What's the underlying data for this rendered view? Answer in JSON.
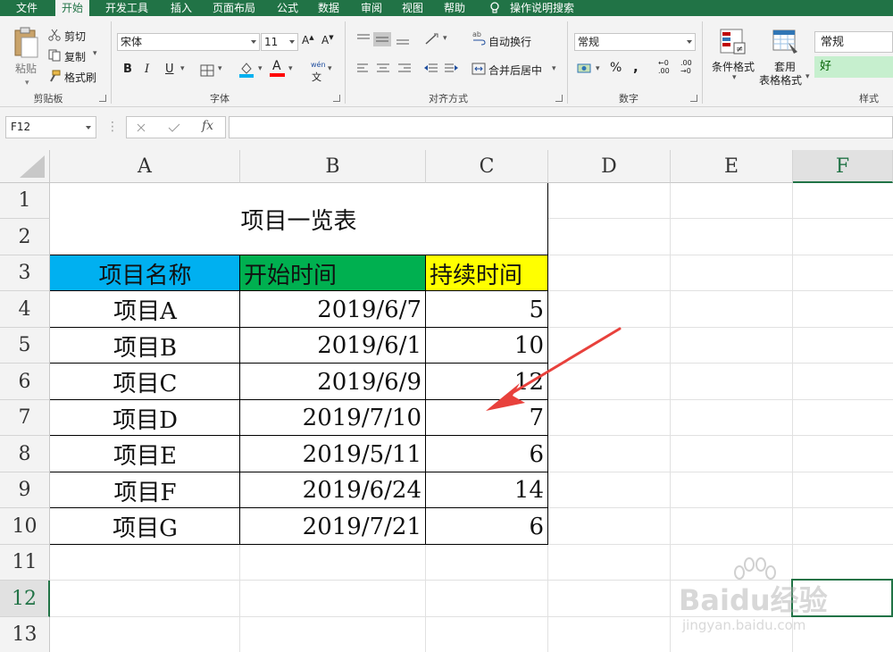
{
  "menu": {
    "tabs": [
      "文件",
      "开始",
      "开发工具",
      "插入",
      "页面布局",
      "公式",
      "数据",
      "审阅",
      "视图",
      "帮助"
    ],
    "active_tab": "开始",
    "tell_me": "操作说明搜索"
  },
  "ribbon": {
    "clipboard": {
      "paste": "粘贴",
      "cut": "剪切",
      "copy": "复制",
      "format_painter": "格式刷",
      "label": "剪贴板"
    },
    "font": {
      "name": "宋体",
      "size": "11",
      "bold": "B",
      "italic": "I",
      "underline": "U",
      "grow": "A",
      "shrink": "A",
      "font_color_glyph": "A",
      "wen": "wén",
      "wen_char": "文",
      "label": "字体"
    },
    "alignment": {
      "wrap": "自动换行",
      "merge": "合并后居中",
      "label": "对齐方式"
    },
    "number": {
      "format": "常规",
      "percent": "%",
      "comma": ",",
      "inc_dec": ".00",
      "label": "数字"
    },
    "styles": {
      "conditional": "条件格式",
      "table_format_1": "套用",
      "table_format_2": "表格格式",
      "normal": "常规",
      "good": "好",
      "label": "样式"
    }
  },
  "formula_bar": {
    "name_box": "F12",
    "fx": "fx",
    "value": ""
  },
  "colors": {
    "excel_green": "#217346",
    "header_blue": "#00b0f0",
    "header_green": "#00b050",
    "header_yellow": "#ffff00",
    "good_fill": "#c6efce",
    "good_text": "#006100"
  },
  "sheet": {
    "columns": [
      "A",
      "B",
      "C",
      "D",
      "E",
      "F"
    ],
    "rows": [
      "1",
      "2",
      "3",
      "4",
      "5",
      "6",
      "7",
      "8",
      "9",
      "10",
      "11",
      "12",
      "13"
    ],
    "selected_cell": "F12",
    "title": "项目一览表",
    "headers": [
      "项目名称",
      "开始时间",
      "持续时间"
    ],
    "data": [
      [
        "项目A",
        "2019/6/7",
        "5"
      ],
      [
        "项目B",
        "2019/6/1",
        "10"
      ],
      [
        "项目C",
        "2019/6/9",
        "12"
      ],
      [
        "项目D",
        "2019/7/10",
        "7"
      ],
      [
        "项目E",
        "2019/5/11",
        "6"
      ],
      [
        "项目F",
        "2019/6/24",
        "14"
      ],
      [
        "项目G",
        "2019/7/21",
        "6"
      ]
    ]
  },
  "watermark": {
    "brand": "Baidu经验",
    "url": "jingyan.baidu.com"
  }
}
